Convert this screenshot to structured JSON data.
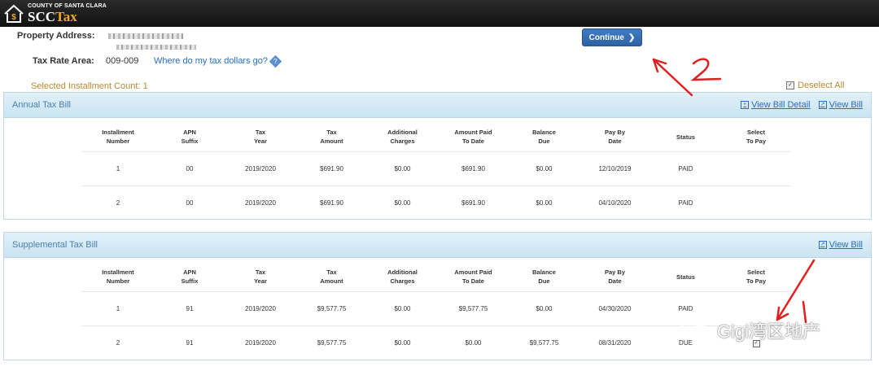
{
  "header": {
    "county": "COUNTY OF SANTA CLARA",
    "brand_a": "SCC",
    "brand_b": "Tax",
    "brand_accent": "#f0a81c"
  },
  "property": {
    "address_label": "Property Address:",
    "tra_label": "Tax Rate Area:",
    "tra_value": "009-009",
    "tax_dollars_link": "Where do my tax dollars go?",
    "help_glyph": "?"
  },
  "actions": {
    "continue_label": "Continue",
    "continue_icon": "chevron-right-icon"
  },
  "selection": {
    "count_text": "Selected Installment Count: 1",
    "deselect_label": "Deselect All"
  },
  "columns": [
    "Installment Number",
    "APN Suffix",
    "Tax Year",
    "Tax Amount",
    "Additional Charges",
    "Amount Paid To Date",
    "Balance Due",
    "Pay By Date",
    "Status",
    "Select To Pay"
  ],
  "column_lines": [
    [
      "Installment",
      "Number"
    ],
    [
      "APN",
      "Suffix"
    ],
    [
      "Tax",
      "Year"
    ],
    [
      "Tax",
      "Amount"
    ],
    [
      "Additional",
      "Charges"
    ],
    [
      "Amount Paid",
      "To Date"
    ],
    [
      "Balance",
      "Due"
    ],
    [
      "Pay By",
      "Date"
    ],
    [
      "Status",
      ""
    ],
    [
      "Select",
      "To Pay"
    ]
  ],
  "annual": {
    "title": "Annual Tax Bill",
    "view_detail_label": "View Bill Detail",
    "view_bill_label": "View Bill",
    "rows": [
      {
        "installment": "1",
        "apn": "00",
        "year": "2019/2020",
        "amount": "$691.90",
        "charges": "$0.00",
        "paid": "$691.90",
        "balance": "$0.00",
        "pay_by": "12/10/2019",
        "status": "PAID",
        "selectable": false
      },
      {
        "installment": "2",
        "apn": "00",
        "year": "2019/2020",
        "amount": "$691.90",
        "charges": "$0.00",
        "paid": "$691.90",
        "balance": "$0.00",
        "pay_by": "04/10/2020",
        "status": "PAID",
        "selectable": false
      }
    ]
  },
  "supplemental": {
    "title": "Supplemental Tax Bill",
    "view_bill_label": "View Bill",
    "rows": [
      {
        "installment": "1",
        "apn": "91",
        "year": "2019/2020",
        "amount": "$9,577.75",
        "charges": "$0.00",
        "paid": "$9,577.75",
        "balance": "$0.00",
        "pay_by": "04/30/2020",
        "status": "PAID",
        "selectable": false
      },
      {
        "installment": "2",
        "apn": "91",
        "year": "2019/2020",
        "amount": "$9,577.75",
        "charges": "$0.00",
        "paid": "$0.00",
        "balance": "$9,577.75",
        "pay_by": "08/31/2020",
        "status": "DUE",
        "selectable": true,
        "checked": true
      }
    ]
  },
  "annotations": {
    "mark_1": "1",
    "mark_2": "2",
    "color": "#e02020"
  },
  "watermark": {
    "text": "Gigi湾区地产"
  }
}
